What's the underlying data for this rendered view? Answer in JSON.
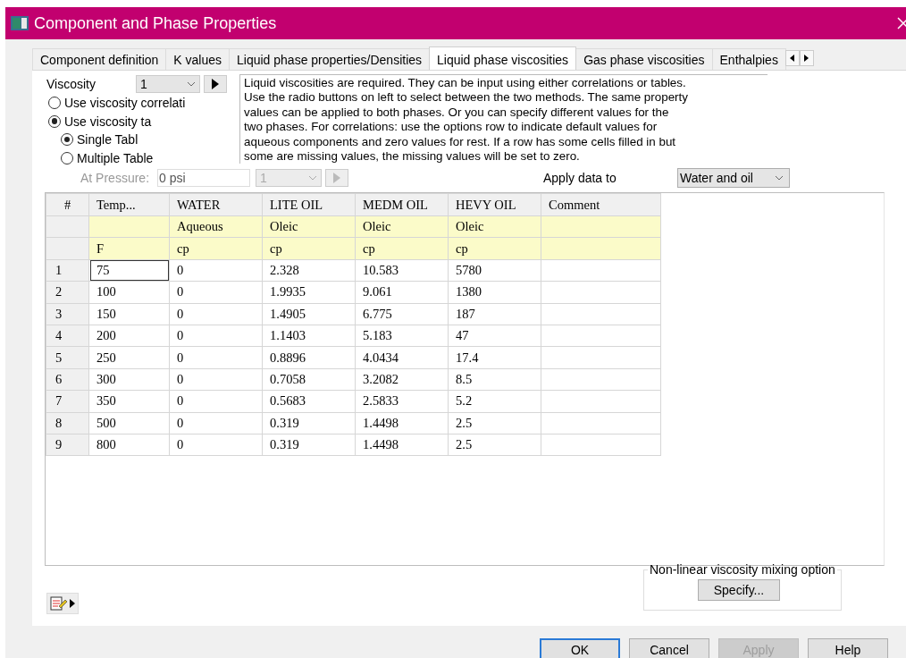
{
  "window": {
    "title": "Component and Phase Properties"
  },
  "tabs": [
    {
      "label": "Component definition",
      "selected": false
    },
    {
      "label": "K values",
      "selected": false
    },
    {
      "label": "Liquid phase properties/Densities",
      "selected": false
    },
    {
      "label": "Liquid phase viscosities",
      "selected": true
    },
    {
      "label": "Gas phase viscosities",
      "selected": false
    },
    {
      "label": "Enthalpies",
      "selected": false
    }
  ],
  "viscosity": {
    "label": "Viscosity",
    "value": "1"
  },
  "methods": [
    {
      "label": "Use viscosity correlati",
      "selected": false
    },
    {
      "label": "Use viscosity ta",
      "selected": true
    }
  ],
  "table_modes": [
    {
      "label": "Single Tabl",
      "selected": true
    },
    {
      "label": "Multiple Table",
      "selected": false
    }
  ],
  "pressure": {
    "label": "At Pressure:",
    "value": "0 psi",
    "index": "1",
    "disabled": true
  },
  "description": "Liquid viscosities are required. They can be input using either correlations or tables.\nUse the radio buttons on left to select between the two methods. The same property\nvalues can be applied to both phases. Or you can specify different values for the\ntwo phases. For correlations: use the options row to indicate default values for\naqueous components and zero values for rest. If a row has some cells filled in but\nsome are missing values, the missing values will be set to zero.",
  "apply_data": {
    "label": "Apply data to",
    "value": "Water and oil"
  },
  "table": {
    "number_header": "#",
    "columns": [
      {
        "header": "Temp...",
        "unit": "F"
      },
      {
        "header": "WATER",
        "option": "Aqueous",
        "unit": "cp"
      },
      {
        "header": "LITE OIL",
        "option": "Oleic",
        "unit": "cp"
      },
      {
        "header": "MEDM OIL",
        "option": "Oleic",
        "unit": "cp"
      },
      {
        "header": "HEVY OIL",
        "option": "Oleic",
        "unit": "cp"
      },
      {
        "header": "Comment"
      }
    ],
    "rows": [
      {
        "number": "1",
        "cells": [
          "75",
          "0",
          "2.328",
          "10.583",
          "5780"
        ]
      },
      {
        "number": "2",
        "cells": [
          "100",
          "0",
          "1.9935",
          "9.061",
          "1380"
        ]
      },
      {
        "number": "3",
        "cells": [
          "150",
          "0",
          "1.4905",
          "6.775",
          "187"
        ]
      },
      {
        "number": "4",
        "cells": [
          "200",
          "0",
          "1.1403",
          "5.183",
          "47"
        ]
      },
      {
        "number": "5",
        "cells": [
          "250",
          "0",
          "0.8896",
          "4.0434",
          "17.4"
        ]
      },
      {
        "number": "6",
        "cells": [
          "300",
          "0",
          "0.7058",
          "3.2082",
          "8.5"
        ]
      },
      {
        "number": "7",
        "cells": [
          "350",
          "0",
          "0.5683",
          "2.5833",
          "5.2"
        ]
      },
      {
        "number": "8",
        "cells": [
          "500",
          "0",
          "0.319",
          "1.4498",
          "2.5"
        ]
      },
      {
        "number": "9",
        "cells": [
          "800",
          "0",
          "0.319",
          "1.4498",
          "2.5"
        ]
      }
    ]
  },
  "mixing": {
    "label": "Non-linear viscosity mixing option",
    "button": "Specify..."
  },
  "buttons": [
    {
      "label": "OK",
      "default": true,
      "disabled": false
    },
    {
      "label": "Cancel",
      "default": false,
      "disabled": false
    },
    {
      "label": "Apply",
      "default": false,
      "disabled": true
    },
    {
      "label": "Help",
      "default": false,
      "disabled": false
    }
  ]
}
